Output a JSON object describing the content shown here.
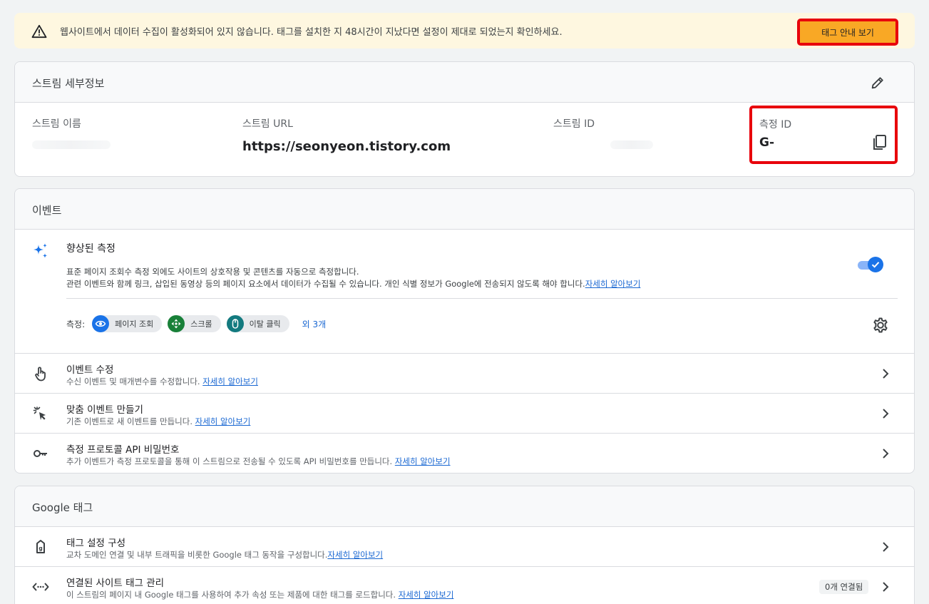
{
  "banner": {
    "message": "웹사이트에서 데이터 수집이 활성화되어 있지 않습니다. 태그를 설치한 지 48시간이 지났다면 설정이 제대로 되었는지 확인하세요.",
    "button_label": "태그 안내 보기"
  },
  "stream_details": {
    "title": "스트림 세부정보",
    "fields": {
      "name": {
        "label": "스트림 이름",
        "value": ""
      },
      "url": {
        "label": "스트림 URL",
        "value": "https://seonyeon.tistory.com"
      },
      "stream_id": {
        "label": "스트림 ID",
        "value": ""
      },
      "measurement_id": {
        "label": "측정 ID",
        "value": "G-"
      }
    }
  },
  "events": {
    "title": "이벤트",
    "enhanced": {
      "name": "향상된 측정",
      "desc_line1": "표준 페이지 조회수 측정 외에도 사이트의 상호작용 및 콘텐츠를 자동으로 측정합니다.",
      "desc_line2": "관련 이벤트와 함께 링크, 삽입된 동영상 등의 페이지 요소에서 데이터가 수집될 수 있습니다. 개인 식별 정보가 Google에 전송되지 않도록 해야 합니다.",
      "learn_more": "자세히 알아보기",
      "measure_label": "측정:",
      "chips": [
        {
          "label": "페이지 조회",
          "icon": "eye-icon",
          "color": "#1a73e8"
        },
        {
          "label": "스크롤",
          "icon": "scroll-icon",
          "color": "#188038"
        },
        {
          "label": "이탈 클릭",
          "icon": "mouse-icon",
          "color": "#137a7f"
        }
      ],
      "more": "외 3개",
      "enabled": true
    },
    "rows": [
      {
        "title": "이벤트 수정",
        "sub": "수신 이벤트 및 매개변수를 수정합니다.",
        "link": "자세히 알아보기",
        "icon": "touch-icon"
      },
      {
        "title": "맞춤 이벤트 만들기",
        "sub": "기존 이벤트로 새 이벤트를 만듭니다.",
        "link": "자세히 알아보기",
        "icon": "click-sparkle-icon"
      },
      {
        "title": "측정 프로토콜 API 비밀번호",
        "sub": "추가 이벤트가 측정 프로토콜을 통해 이 스트림으로 전송될 수 있도록 API 비밀번호를 만듭니다.",
        "link": "자세히 알아보기",
        "icon": "key-icon"
      }
    ]
  },
  "google_tag": {
    "title": "Google 태그",
    "rows": [
      {
        "title": "태그 설정 구성",
        "sub": "교차 도메인 연결 및 내부 트래픽을 비롯한 Google 태그 동작을 구성합니다.",
        "link": "자세히 알아보기",
        "icon": "tag-icon"
      },
      {
        "title": "연결된 사이트 태그 관리",
        "sub": "이 스트림의 페이지 내 Google 태그를 사용하여 추가 속성 또는 제품에 대한 태그를 로드합니다.",
        "link": "자세히 알아보기",
        "icon": "code-icon",
        "badge": "0개 연결됨"
      }
    ]
  },
  "colors": {
    "accent": "#1a73e8",
    "highlight": "#e8000b",
    "button": "#f9a825",
    "banner_bg": "#fef7e0"
  }
}
